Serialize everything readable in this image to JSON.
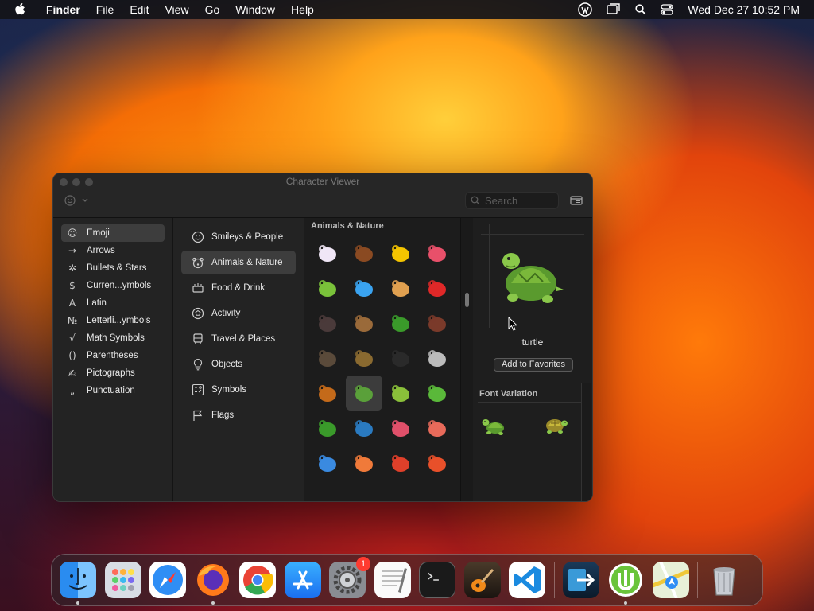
{
  "menubar": {
    "app_name": "Finder",
    "items": [
      "File",
      "Edit",
      "View",
      "Go",
      "Window",
      "Help"
    ],
    "clock": "Wed Dec 27  10:52 PM"
  },
  "window": {
    "title": "Character Viewer",
    "search_placeholder": "Search",
    "categories": [
      {
        "label": "Emoji",
        "icon": "☺",
        "selected": true
      },
      {
        "label": "Arrows",
        "icon": "→"
      },
      {
        "label": "Bullets & Stars",
        "icon": "✲"
      },
      {
        "label": "Curren...ymbols",
        "icon": "$"
      },
      {
        "label": "Latin",
        "icon": "A"
      },
      {
        "label": "Letterli...ymbols",
        "icon": "№"
      },
      {
        "label": "Math Symbols",
        "icon": "√"
      },
      {
        "label": "Parentheses",
        "icon": "()"
      },
      {
        "label": "Pictographs",
        "icon": "✍"
      },
      {
        "label": "Punctuation",
        "icon": "„"
      }
    ],
    "emoji_groups": [
      {
        "label": "Smileys & People",
        "icon": "smiley-icon"
      },
      {
        "label": "Animals & Nature",
        "icon": "bear-icon",
        "selected": true
      },
      {
        "label": "Food & Drink",
        "icon": "food-icon"
      },
      {
        "label": "Activity",
        "icon": "ball-icon"
      },
      {
        "label": "Travel & Places",
        "icon": "bus-icon"
      },
      {
        "label": "Objects",
        "icon": "bulb-icon"
      },
      {
        "label": "Symbols",
        "icon": "symbols-icon"
      },
      {
        "label": "Flags",
        "icon": "flag-icon"
      }
    ],
    "grid_header": "Animals & Nature",
    "emoji_grid": [
      {
        "name": "unicorn",
        "color": "#f0e6f6"
      },
      {
        "name": "moose",
        "color": "#8a4a22"
      },
      {
        "name": "bee",
        "color": "#f4c400"
      },
      {
        "name": "worm",
        "color": "#e8506a"
      },
      {
        "name": "caterpillar",
        "color": "#7ac23a"
      },
      {
        "name": "butterfly",
        "color": "#3aa3f0"
      },
      {
        "name": "snail",
        "color": "#e0a050"
      },
      {
        "name": "ladybug",
        "color": "#e02828"
      },
      {
        "name": "ant",
        "color": "#4a3a3a"
      },
      {
        "name": "fly",
        "color": "#9a6a3a"
      },
      {
        "name": "beetle",
        "color": "#3a9a2a"
      },
      {
        "name": "cockroach",
        "color": "#7a3a2a"
      },
      {
        "name": "mosquito",
        "color": "#5a4a3a"
      },
      {
        "name": "cricket",
        "color": "#8a6a30"
      },
      {
        "name": "spider",
        "color": "#2a2a2a"
      },
      {
        "name": "spider-web",
        "color": "#bbbbbb"
      },
      {
        "name": "scorpion",
        "color": "#c46a1a"
      },
      {
        "name": "turtle",
        "color": "#5aa03a",
        "selected": true
      },
      {
        "name": "snake",
        "color": "#8ac03a"
      },
      {
        "name": "lizard",
        "color": "#5ab83a"
      },
      {
        "name": "t-rex",
        "color": "#3a9a2a"
      },
      {
        "name": "sauropod",
        "color": "#2a7ac0"
      },
      {
        "name": "octopus",
        "color": "#e0506a"
      },
      {
        "name": "squid",
        "color": "#e86a5a"
      },
      {
        "name": "jellyfish",
        "color": "#3a8ae0"
      },
      {
        "name": "shrimp",
        "color": "#f07a3a"
      },
      {
        "name": "lobster",
        "color": "#e0402a"
      },
      {
        "name": "crab",
        "color": "#e8502a"
      }
    ],
    "preview": {
      "name": "turtle",
      "add_favorites_label": "Add to Favorites",
      "font_variation_title": "Font Variation"
    }
  },
  "dock": {
    "apps": [
      {
        "name": "Finder",
        "running": true
      },
      {
        "name": "Launchpad"
      },
      {
        "name": "Safari"
      },
      {
        "name": "Firefox",
        "running": true
      },
      {
        "name": "Chrome"
      },
      {
        "name": "App Store"
      },
      {
        "name": "System Preferences",
        "badge": "1"
      },
      {
        "name": "TextEdit"
      },
      {
        "name": "Terminal"
      },
      {
        "name": "GarageBand"
      },
      {
        "name": "Visual Studio Code"
      },
      {
        "name": "Migration Assistant"
      },
      {
        "name": "uTorrent",
        "running": true
      },
      {
        "name": "Maps"
      },
      {
        "name": "Trash"
      }
    ]
  }
}
